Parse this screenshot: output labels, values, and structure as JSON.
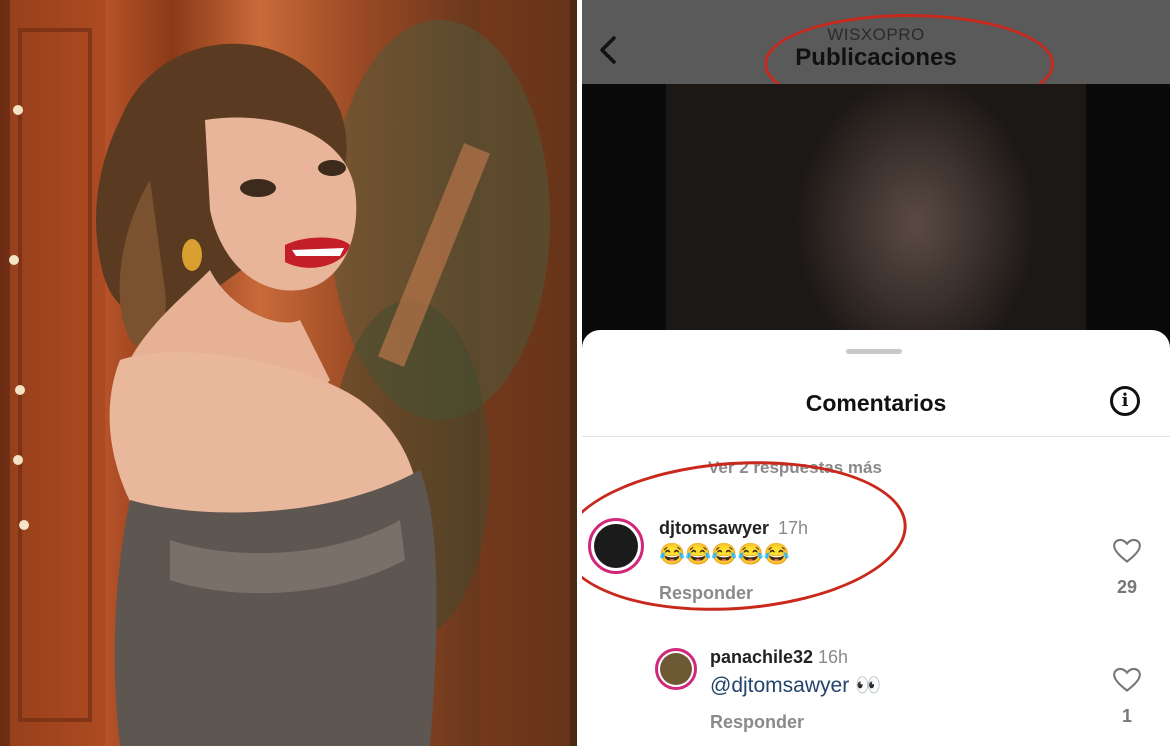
{
  "header": {
    "kicker": "WISXOPRO",
    "title": "Publicaciones"
  },
  "sheet": {
    "title": "Comentarios",
    "view_more": "Ver 2 respuestas más"
  },
  "comments": [
    {
      "username": "djtomsawyer",
      "time": "17h",
      "text": "😂😂😂😂😂",
      "reply_label": "Responder",
      "likes": "29"
    },
    {
      "username": "panachile32",
      "time": "16h",
      "mention": "@djtomsawyer",
      "text": " 👀",
      "reply_label": "Responder",
      "likes": "1"
    }
  ],
  "colors": {
    "annotation_red": "#c9281c",
    "story_ring": "#d0287a",
    "mention_blue": "#23446b"
  }
}
